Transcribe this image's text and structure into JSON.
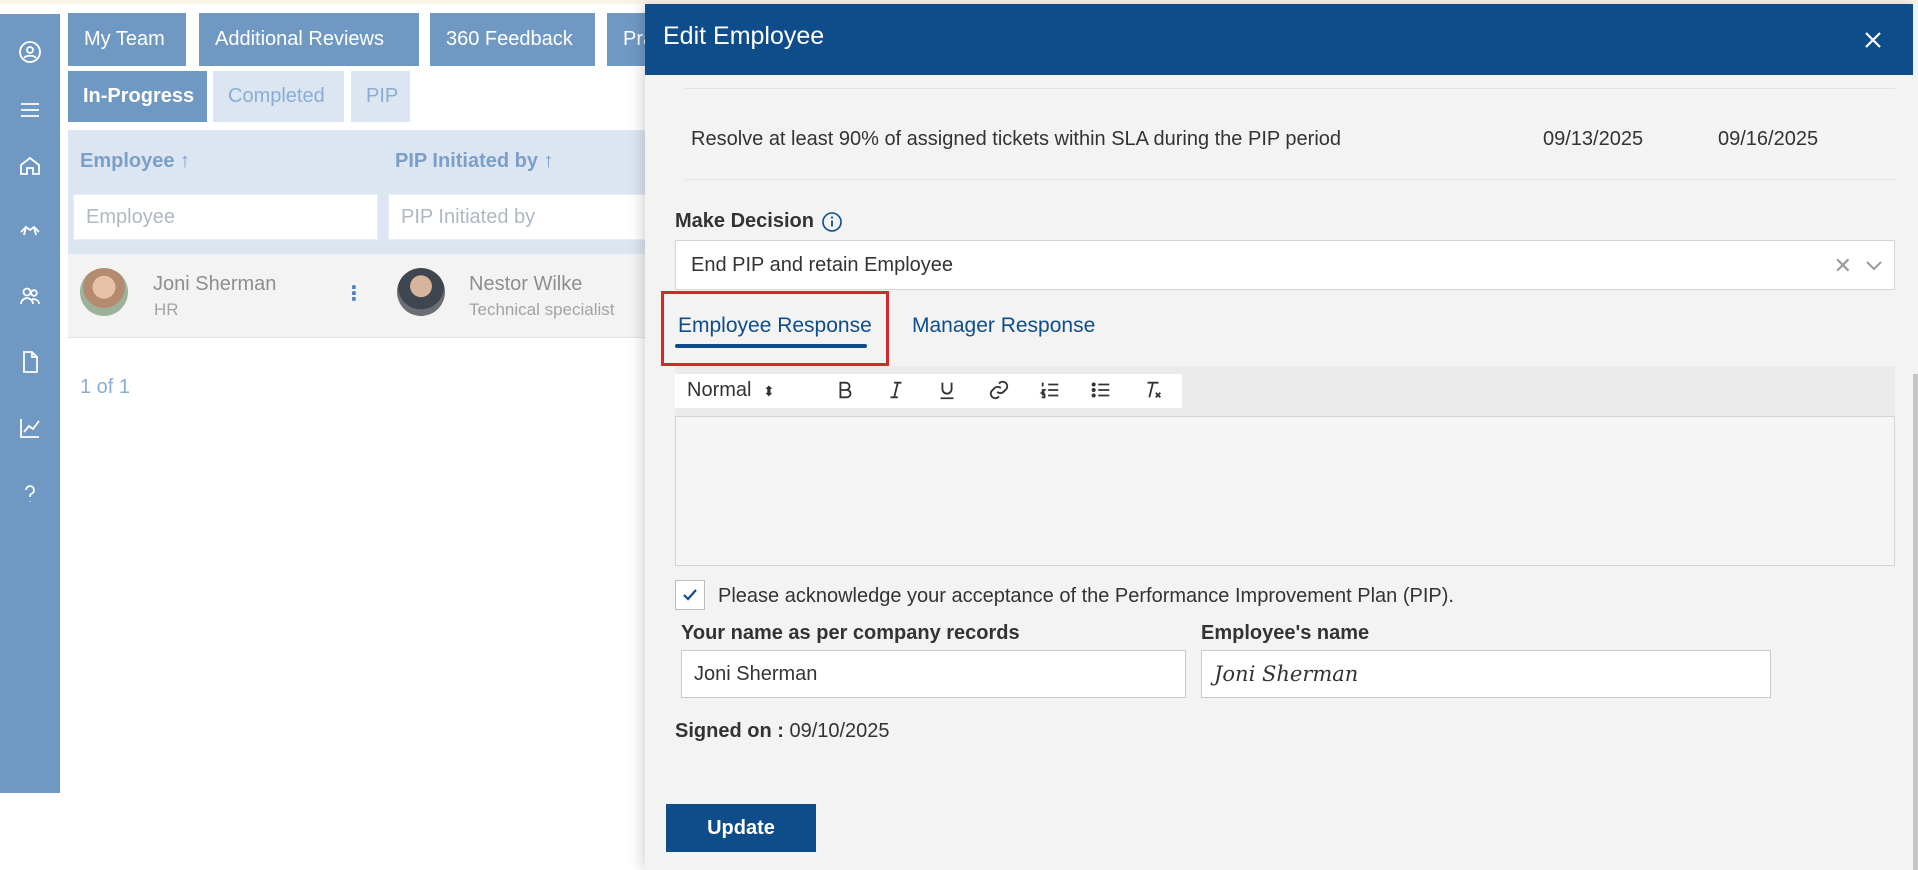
{
  "top_tabs": [
    {
      "label": "My Team"
    },
    {
      "label": "Additional Reviews"
    },
    {
      "label": "360 Feedback"
    },
    {
      "label": "Pra"
    }
  ],
  "sub_tabs": [
    {
      "label": "In-Progress",
      "active": true
    },
    {
      "label": "Completed",
      "active": false
    },
    {
      "label": "PIP",
      "active": false
    }
  ],
  "grid": {
    "columns": [
      {
        "title": "Employee ↑",
        "filter_placeholder": "Employee"
      },
      {
        "title": "PIP Initiated by ↑",
        "filter_placeholder": "PIP Initiated by"
      }
    ],
    "rows": [
      {
        "employee_name": "Joni Sherman",
        "employee_role": "HR",
        "initiator_name": "Nestor Wilke",
        "initiator_role": "Technical specialist",
        "menu": "⋮"
      }
    ],
    "pager": "1 of 1"
  },
  "modal": {
    "title": "Edit Employee",
    "goal": {
      "text": "Resolve at least 90% of assigned tickets within SLA during the PIP period",
      "start_date": "09/13/2025",
      "end_date": "09/16/2025"
    },
    "decision": {
      "label": "Make Decision",
      "value": "End PIP and retain Employee",
      "clear_glyph": "✕"
    },
    "response_tabs": [
      {
        "label": "Employee Response",
        "active": true
      },
      {
        "label": "Manager Response",
        "active": false
      }
    ],
    "editor": {
      "format": "Normal",
      "content": ""
    },
    "acknowledge": {
      "checked": true,
      "text": "Please acknowledge your acceptance of the Performance Improvement Plan (PIP)."
    },
    "name_field": {
      "label": "Your name as per company records",
      "value": "Joni Sherman"
    },
    "signature_field": {
      "label": "Employee's name",
      "value": "Joni Sherman"
    },
    "signed_on": {
      "label": "Signed on :",
      "value": "09/10/2025"
    },
    "update_label": "Update"
  },
  "colors": {
    "brand": "#0e4d8a",
    "rail": "#6f98c3",
    "highlight": "#d9262b"
  }
}
